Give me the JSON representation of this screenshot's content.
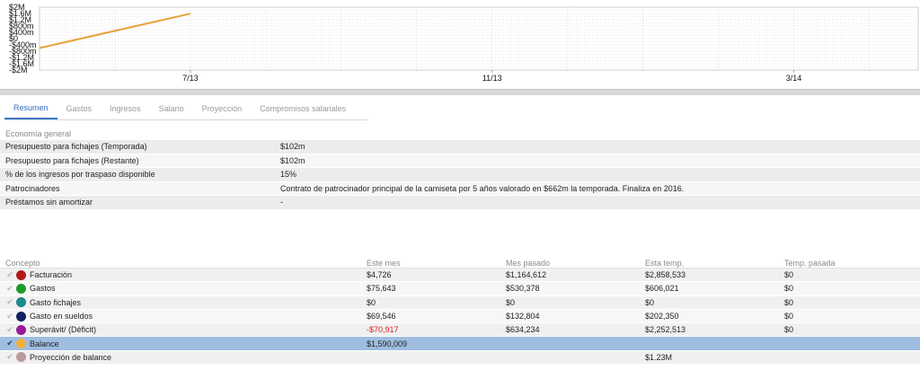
{
  "chart_data": {
    "type": "line",
    "x_ticks": [
      "7/13",
      "11/13",
      "3/14"
    ],
    "y_ticks": [
      "$2M",
      "$1.6M",
      "$1.2M",
      "$800m",
      "$400m",
      "$0",
      "-$400m",
      "-$800m",
      "-$1.2M",
      "-$1.6M",
      "-$2M"
    ],
    "ylim": [
      -2000000,
      2000000
    ],
    "x_range_months": [
      "2013-05",
      "2014-04"
    ],
    "series": [
      {
        "color": "#e8a23a",
        "x": [
          "2013-05",
          "2013-07"
        ],
        "y": [
          -600000,
          1590009
        ]
      }
    ],
    "grid": true
  },
  "tabs": [
    {
      "label": "Resumen",
      "active": true
    },
    {
      "label": "Gastos"
    },
    {
      "label": "Ingresos"
    },
    {
      "label": "Salario"
    },
    {
      "label": "Proyección"
    },
    {
      "label": "Compromisos salariales"
    }
  ],
  "general": {
    "title": "Economía general",
    "rows": [
      {
        "label": "Presupuesto para fichajes (Temporada)",
        "value": "$102m"
      },
      {
        "label": "Presupuesto para fichajes (Restante)",
        "value": "$102m"
      },
      {
        "label": "% de los ingresos por traspaso disponible",
        "value": "15%"
      },
      {
        "label": "Patrocinadores",
        "value": "Contrato de patrocinador principal de la camiseta por 5 años valorado en $662m la temporada. Finaliza en 2016."
      },
      {
        "label": "Préstamos sin amortizar",
        "value": "-"
      }
    ]
  },
  "table": {
    "headers": [
      "Concepto",
      "Este mes",
      "Mes pasado",
      "Esta temp.",
      "Temp. pasada"
    ],
    "rows": [
      {
        "name": "Facturación",
        "color": "#b01818",
        "v": [
          "$4,726",
          "$1,164,612",
          "$2,858,533",
          "$0"
        ]
      },
      {
        "name": "Gastos",
        "color": "#1e9a2e",
        "v": [
          "$75,643",
          "$530,378",
          "$606,021",
          "$0"
        ]
      },
      {
        "name": "Gasto fichajes",
        "color": "#1a8a8a",
        "v": [
          "$0",
          "$0",
          "$0",
          "$0"
        ]
      },
      {
        "name": "Gasto en sueldos",
        "color": "#13205e",
        "v": [
          "$69,546",
          "$132,804",
          "$202,350",
          "$0"
        ]
      },
      {
        "name": "Superávit/ (Déficit)",
        "color": "#9a1a9a",
        "v": [
          "-$70,917",
          "$634,234",
          "$2,252,513",
          "$0"
        ],
        "neg0": true
      },
      {
        "name": "Balance",
        "color": "#f0b040",
        "v": [
          "$1,590,009",
          "",
          "",
          ""
        ],
        "selected": true
      },
      {
        "name": "Proyección de balance",
        "color": "#b89a9a",
        "v": [
          "",
          "",
          "$1.23M",
          ""
        ]
      }
    ]
  }
}
